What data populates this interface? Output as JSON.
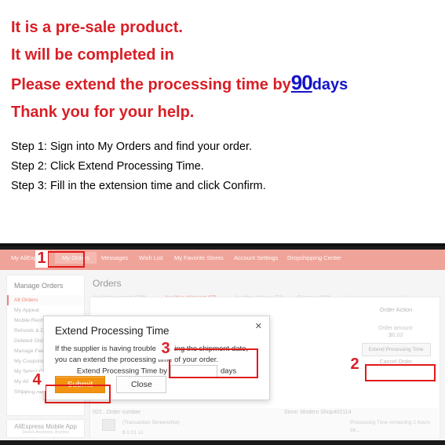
{
  "notice": {
    "line1": "It is a pre-sale product.",
    "line2": "It will be completed in",
    "line3_prefix": "Please extend the processing time by",
    "line3_number": "90",
    "line3_unit": "days",
    "line4": "Thank you for your help.",
    "color": "#d81f26",
    "number_color": "#1414c8"
  },
  "steps": {
    "step1": "Step 1: Sign into My Orders and find your order.",
    "step2": "Step 2: Click Extend Processing Time.",
    "step3": "Step 3: Fill in the extension time and click Confirm."
  },
  "screenshot": {
    "nav": {
      "items": [
        {
          "label": "My AliExpress",
          "selected": false
        },
        {
          "label": "My Orders",
          "selected": true
        },
        {
          "label": "Messages",
          "selected": false
        },
        {
          "label": "Wish List",
          "selected": false
        },
        {
          "label": "My Favorite Stores",
          "selected": false
        },
        {
          "label": "Account Settings",
          "selected": false
        },
        {
          "label": "Dropshipping Center",
          "selected": false
        }
      ],
      "background": "#f0a499"
    },
    "sidebar": {
      "heading": "Manage Orders",
      "items": [
        {
          "label": "All Orders",
          "active": true
        },
        {
          "label": "My Appeal",
          "active": false
        },
        {
          "label": "Mobile Recharge",
          "active": false
        },
        {
          "label": "Refunds & Disputes",
          "active": false
        },
        {
          "label": "Deleted Orders",
          "active": false
        },
        {
          "label": "Manage Feedback",
          "active": false
        },
        {
          "label": "My Coupons",
          "active": false
        },
        {
          "label": "My Select Coupon",
          "active": false
        },
        {
          "label": "My AliExpress Pocket",
          "active": false
        },
        {
          "label": "Shipping Address",
          "active": false
        }
      ],
      "app_promo_title": "AliExpress Mobile App",
      "app_promo_sub": "Search Anywhere, Anytime"
    },
    "main": {
      "page_title": "Orders",
      "tabs": [
        {
          "label": "Awaiting payment (509)",
          "state": "normal"
        },
        {
          "label": "Awaiting shipment (27)",
          "state": "active"
        },
        {
          "label": "Awaiting delivery (53)",
          "state": "normal"
        },
        {
          "label": "Disputes (192)",
          "state": "normal"
        },
        {
          "label": "Unread order messages (14)",
          "state": "dim"
        }
      ]
    },
    "order_row": {
      "order_number": "022...Order number",
      "store": "Store: Modern Shop402114",
      "transaction": "(Transaction Screenshot)",
      "price": "$ 0.01 x1",
      "processing_time": "Processing Time remaining 2 hours 56..."
    },
    "order_action": {
      "heading": "Order Action",
      "amount_label": "Order amount:",
      "amount_value": "$0.02",
      "extend_button": "Extend Processing Time",
      "cancel_link": "Cancel Order"
    },
    "modal": {
      "title": "Extend Processing Time",
      "body_line1": "If the supplier is having trouble meeting the shipment date, you",
      "body_line2": "can extend the processing time of your order.",
      "field_prefix": "Extend Processing Time by",
      "field_value": "",
      "field_suffix": "days",
      "submit_label": "Submit",
      "close_label": "Close",
      "close_icon": "✕",
      "submit_color": "#f2920f"
    },
    "annotations": {
      "a1": "1",
      "a2": "2",
      "a3": "3",
      "a4": "4",
      "color": "#e01b1b"
    }
  }
}
